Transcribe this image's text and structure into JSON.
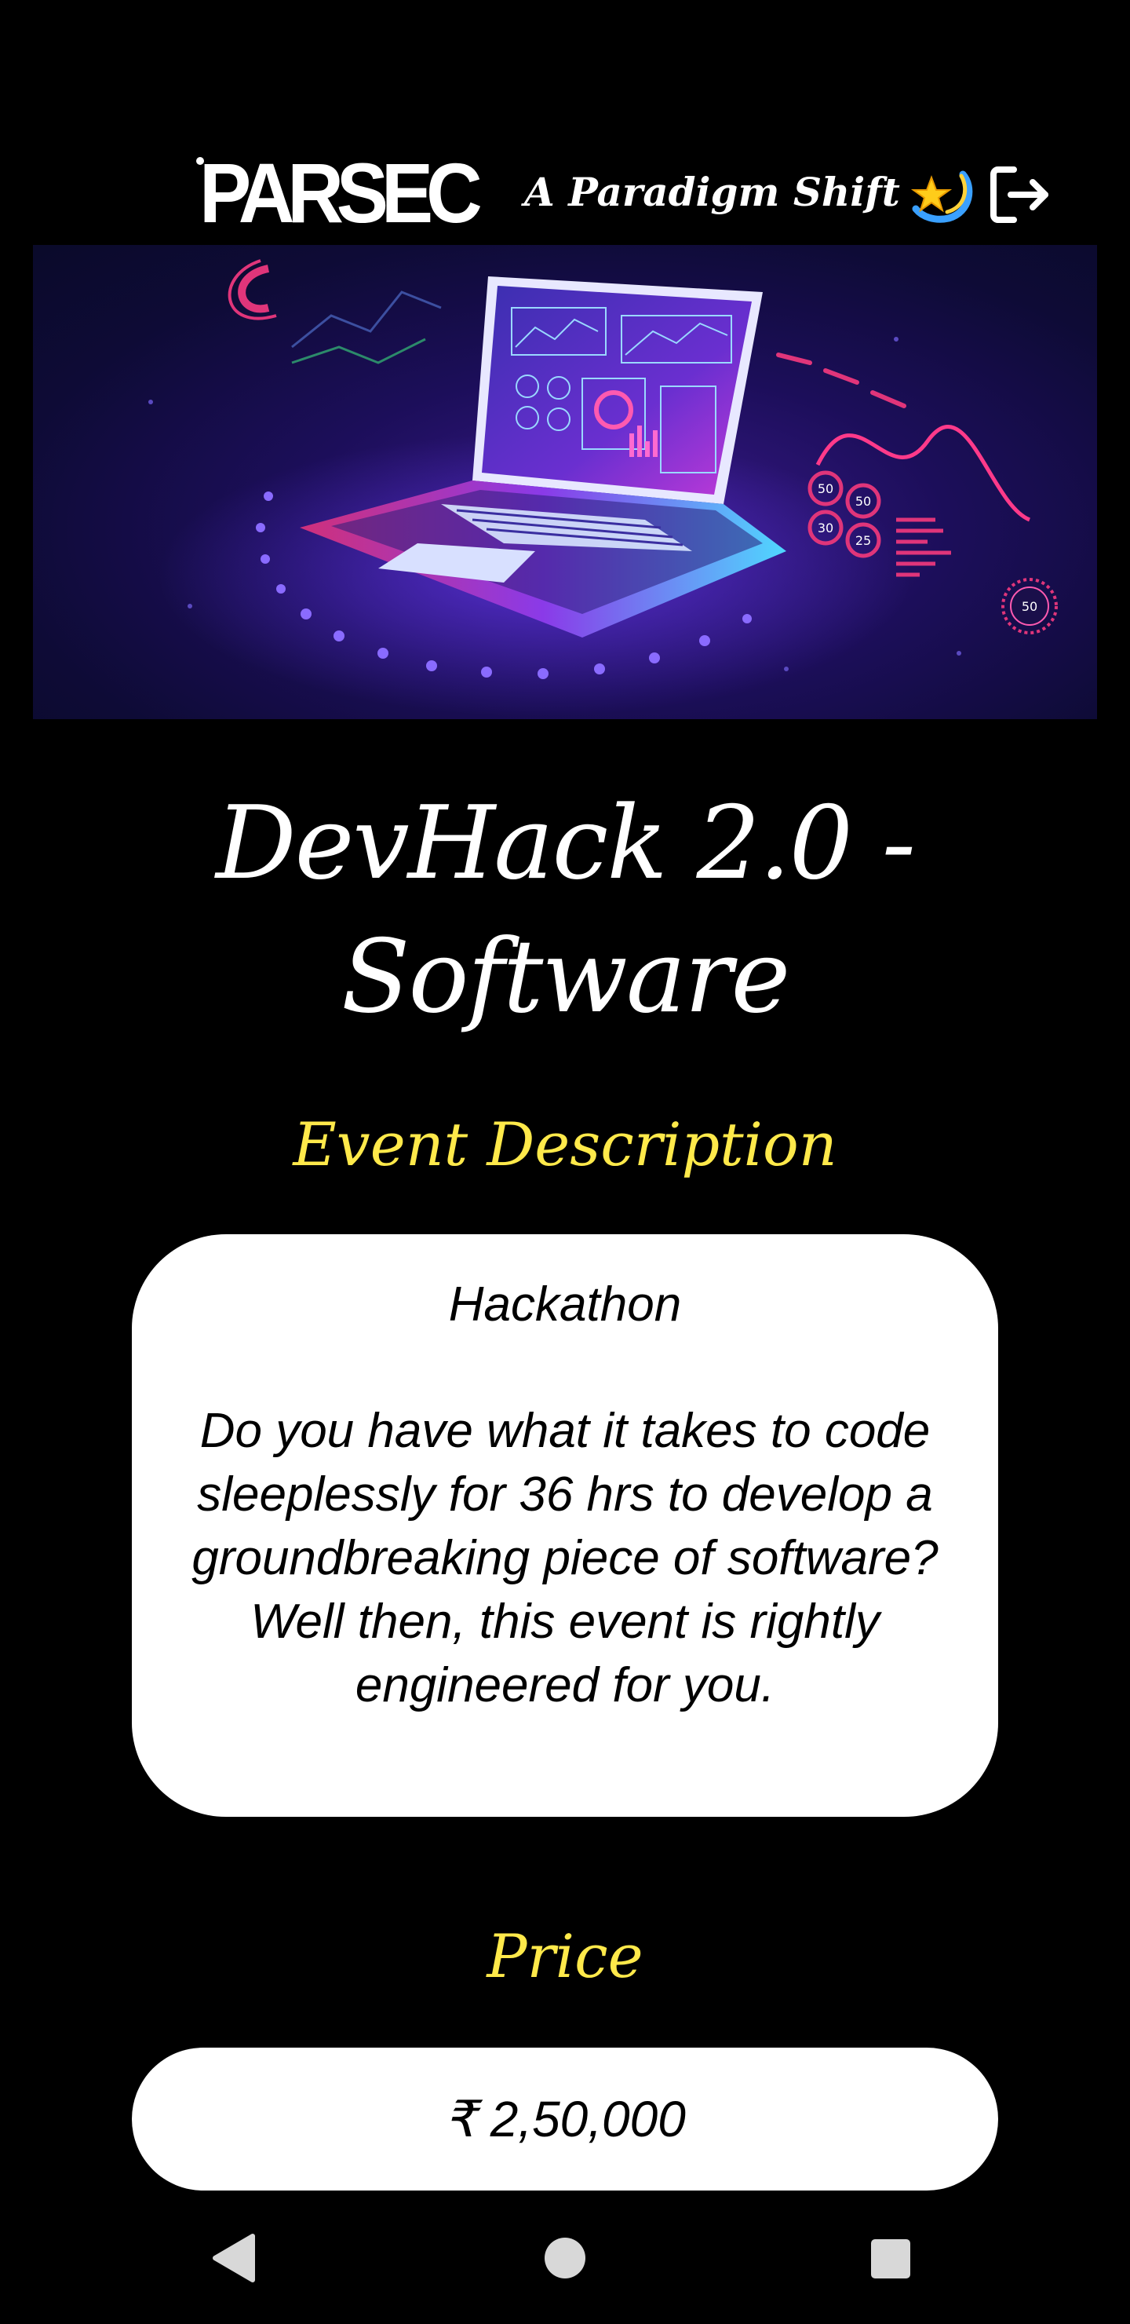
{
  "header": {
    "logo_text": "PARSEC",
    "tagline": "A Paradigm Shift",
    "tagline_icon": "shooting-star-icon",
    "logout_icon": "logout-icon"
  },
  "banner": {
    "image": "laptop-dashboard-illustration",
    "gauge_labels": [
      "50",
      "50",
      "30",
      "25",
      "50"
    ]
  },
  "event": {
    "title": "DevHack 2.0 - Software"
  },
  "description": {
    "heading": "Event Description",
    "type": "Hackathon",
    "body": "Do you have what it takes to code sleeplessly for 36 hrs to develop a groundbreaking piece of software? Well then, this event is rightly engineered for you."
  },
  "price": {
    "heading": "Price",
    "value": "₹ 2,50,000"
  },
  "navbar": {
    "back_icon": "back-triangle-icon",
    "home_icon": "home-circle-icon",
    "recents_icon": "recents-square-icon"
  },
  "colors": {
    "background": "#000000",
    "heading_accent": "#ffe94a",
    "card_background": "#ffffff",
    "banner_purple": "#2a1470",
    "banner_pink": "#e0357a",
    "banner_cyan": "#5fe6ff"
  }
}
